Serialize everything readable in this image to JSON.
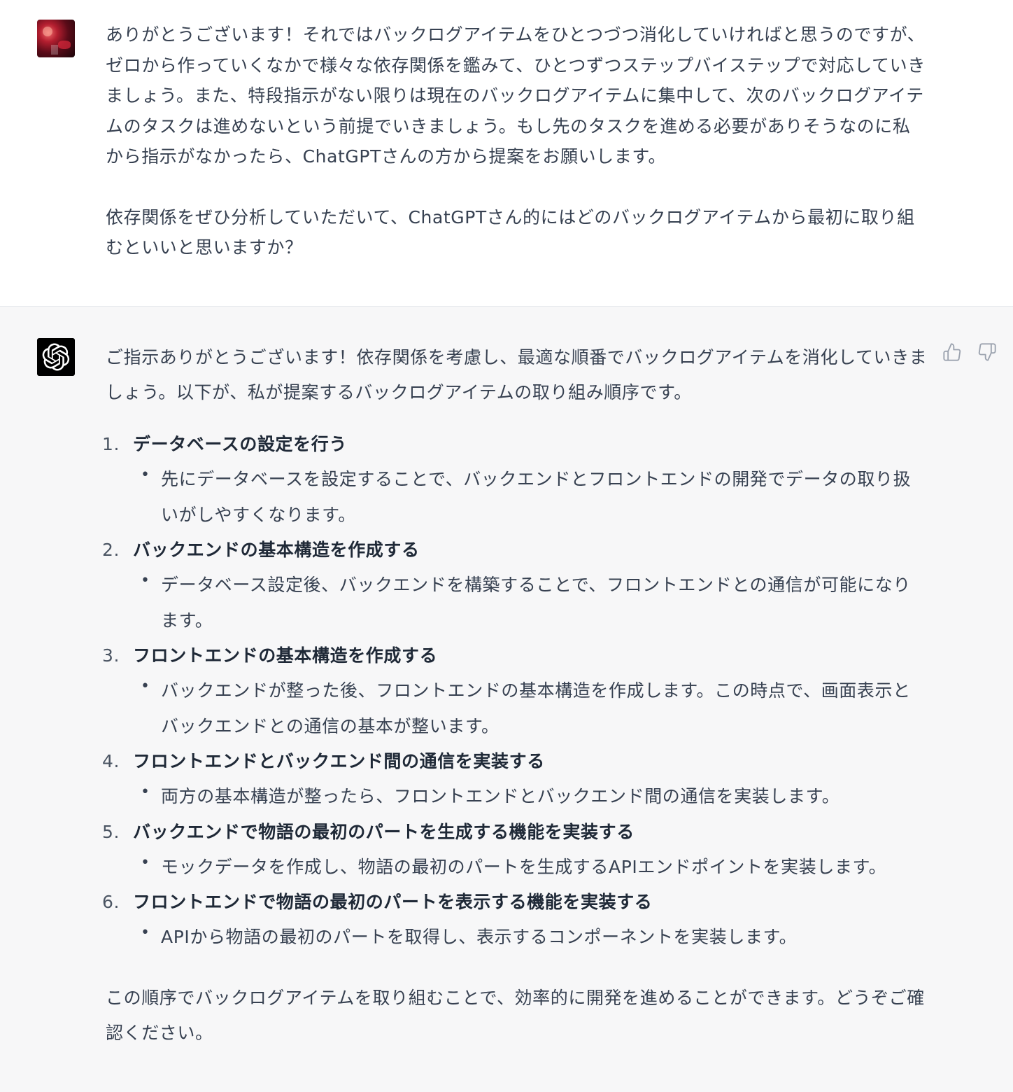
{
  "user_message": {
    "avatar": "user-photo-avatar",
    "paragraphs": [
      "ありがとうございます！それではバックログアイテムをひとつづつ消化していければと思うのですが、ゼロから作っていくなかで様々な依存関係を鑑みて、ひとつずつステップバイステップで対応していきましょう。また、特段指示がない限りは現在のバックログアイテムに集中して、次のバックログアイテムのタスクは進めないという前提でいきましょう。もし先のタスクを進める必要がありそうなのに私から指示がなかったら、ChatGPTさんの方から提案をお願いします。",
      "依存関係をぜひ分析していただいて、ChatGPTさん的にはどのバックログアイテムから最初に取り組むといいと思いますか？"
    ]
  },
  "assistant_message": {
    "avatar": "openai-logo-icon",
    "intro": "ご指示ありがとうございます！依存関係を考慮し、最適な順番でバックログアイテムを消化していきましょう。以下が、私が提案するバックログアイテムの取り組み順序です。",
    "steps": [
      {
        "number": "1.",
        "title": "データベースの設定を行う",
        "detail": "先にデータベースを設定することで、バックエンドとフロントエンドの開発でデータの取り扱いがしやすくなります。"
      },
      {
        "number": "2.",
        "title": "バックエンドの基本構造を作成する",
        "detail": "データベース設定後、バックエンドを構築することで、フロントエンドとの通信が可能になります。"
      },
      {
        "number": "3.",
        "title": "フロントエンドの基本構造を作成する",
        "detail": "バックエンドが整った後、フロントエンドの基本構造を作成します。この時点で、画面表示とバックエンドとの通信の基本が整います。"
      },
      {
        "number": "4.",
        "title": "フロントエンドとバックエンド間の通信を実装する",
        "detail": "両方の基本構造が整ったら、フロントエンドとバックエンド間の通信を実装します。"
      },
      {
        "number": "5.",
        "title": "バックエンドで物語の最初のパートを生成する機能を実装する",
        "detail": "モックデータを作成し、物語の最初のパートを生成するAPIエンドポイントを実装します。"
      },
      {
        "number": "6.",
        "title": "フロントエンドで物語の最初のパートを表示する機能を実装する",
        "detail": "APIから物語の最初のパートを取得し、表示するコンポーネントを実装します。"
      }
    ],
    "bullet_symbol": "•",
    "outro": "この順序でバックログアイテムを取り組むことで、効率的に開発を進めることができます。どうぞご確認ください。"
  },
  "feedback": {
    "thumbs_up_icon": "thumbs-up-icon",
    "thumbs_down_icon": "thumbs-down-icon"
  },
  "colors": {
    "user_bg": "#ffffff",
    "assistant_bg": "#f7f7f8",
    "text": "#374151",
    "bold_text": "#1f2937",
    "icon": "#9ca3af"
  }
}
